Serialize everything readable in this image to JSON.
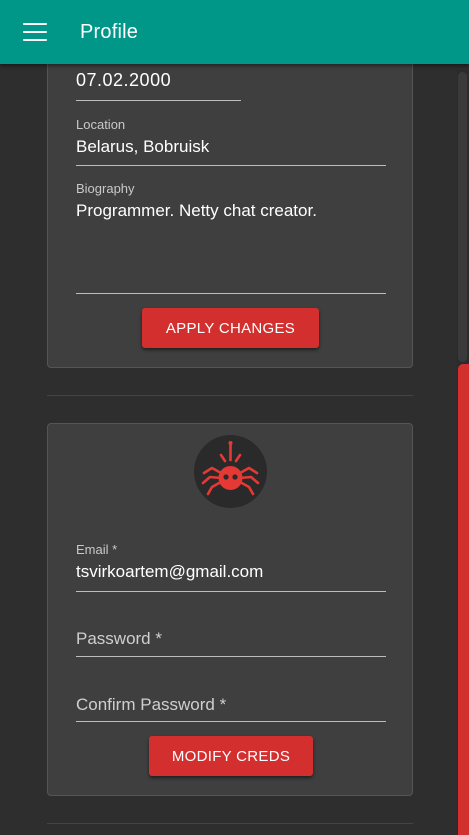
{
  "app_bar": {
    "title": "Profile"
  },
  "profile_card": {
    "birth_date": "07.02.2000",
    "location_label": "Location",
    "location_value": "Belarus, Bobruisk",
    "biography_label": "Biography",
    "biography_value": "Programmer. Netty chat creator.",
    "apply_button": "APPLY CHANGES"
  },
  "creds_card": {
    "avatar_icon": "spider-icon",
    "email_label": "Email *",
    "email_value": "tsvirkoartem@gmail.com",
    "password_placeholder": "Password *",
    "confirm_password_placeholder": "Confirm Password *",
    "modify_button": "MODIFY CREDS"
  },
  "colors": {
    "app_bar": "#009688",
    "accent": "#d32f2f",
    "background": "#2e2e2e",
    "card": "#3f3f3f"
  }
}
